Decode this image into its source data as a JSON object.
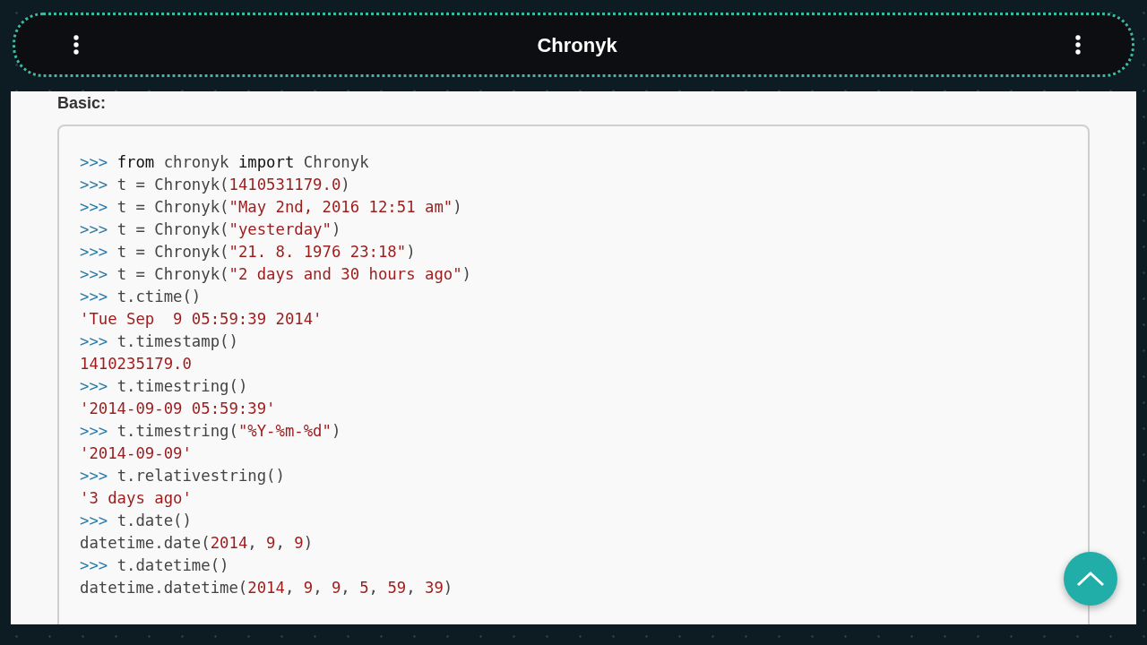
{
  "app_bar": {
    "title": "Chronyk"
  },
  "section": {
    "heading": "Basic:"
  },
  "code_lines": [
    [
      {
        "kind": "prompt",
        "text": ">>> "
      },
      {
        "kind": "keyword",
        "text": "from"
      },
      {
        "kind": "plain",
        "text": " chronyk "
      },
      {
        "kind": "keyword",
        "text": "import"
      },
      {
        "kind": "plain",
        "text": " Chronyk"
      }
    ],
    [
      {
        "kind": "prompt",
        "text": ">>> "
      },
      {
        "kind": "plain",
        "text": "t = Chronyk("
      },
      {
        "kind": "literal",
        "text": "1410531179.0"
      },
      {
        "kind": "plain",
        "text": ")"
      }
    ],
    [
      {
        "kind": "prompt",
        "text": ">>> "
      },
      {
        "kind": "plain",
        "text": "t = Chronyk("
      },
      {
        "kind": "literal",
        "text": "\"May 2nd, 2016 12:51 am\""
      },
      {
        "kind": "plain",
        "text": ")"
      }
    ],
    [
      {
        "kind": "prompt",
        "text": ">>> "
      },
      {
        "kind": "plain",
        "text": "t = Chronyk("
      },
      {
        "kind": "literal",
        "text": "\"yesterday\""
      },
      {
        "kind": "plain",
        "text": ")"
      }
    ],
    [
      {
        "kind": "prompt",
        "text": ">>> "
      },
      {
        "kind": "plain",
        "text": "t = Chronyk("
      },
      {
        "kind": "literal",
        "text": "\"21. 8. 1976 23:18\""
      },
      {
        "kind": "plain",
        "text": ")"
      }
    ],
    [
      {
        "kind": "prompt",
        "text": ">>> "
      },
      {
        "kind": "plain",
        "text": "t = Chronyk("
      },
      {
        "kind": "literal",
        "text": "\"2 days and 30 hours ago\""
      },
      {
        "kind": "plain",
        "text": ")"
      }
    ],
    [
      {
        "kind": "prompt",
        "text": ">>> "
      },
      {
        "kind": "plain",
        "text": "t.ctime()"
      }
    ],
    [
      {
        "kind": "literal",
        "text": "'Tue Sep  9 05:59:39 2014'"
      }
    ],
    [
      {
        "kind": "prompt",
        "text": ">>> "
      },
      {
        "kind": "plain",
        "text": "t.timestamp()"
      }
    ],
    [
      {
        "kind": "literal",
        "text": "1410235179.0"
      }
    ],
    [
      {
        "kind": "prompt",
        "text": ">>> "
      },
      {
        "kind": "plain",
        "text": "t.timestring()"
      }
    ],
    [
      {
        "kind": "literal",
        "text": "'2014-09-09 05:59:39'"
      }
    ],
    [
      {
        "kind": "prompt",
        "text": ">>> "
      },
      {
        "kind": "plain",
        "text": "t.timestring("
      },
      {
        "kind": "literal",
        "text": "\"%Y-%m-%d\""
      },
      {
        "kind": "plain",
        "text": ")"
      }
    ],
    [
      {
        "kind": "literal",
        "text": "'2014-09-09'"
      }
    ],
    [
      {
        "kind": "prompt",
        "text": ">>> "
      },
      {
        "kind": "plain",
        "text": "t.relativestring()"
      }
    ],
    [
      {
        "kind": "literal",
        "text": "'3 days ago'"
      }
    ],
    [
      {
        "kind": "prompt",
        "text": ">>> "
      },
      {
        "kind": "plain",
        "text": "t.date()"
      }
    ],
    [
      {
        "kind": "plain",
        "text": "datetime.date("
      },
      {
        "kind": "literal",
        "text": "2014"
      },
      {
        "kind": "plain",
        "text": ", "
      },
      {
        "kind": "literal",
        "text": "9"
      },
      {
        "kind": "plain",
        "text": ", "
      },
      {
        "kind": "literal",
        "text": "9"
      },
      {
        "kind": "plain",
        "text": ")"
      }
    ],
    [
      {
        "kind": "prompt",
        "text": ">>> "
      },
      {
        "kind": "plain",
        "text": "t.datetime()"
      }
    ],
    [
      {
        "kind": "plain",
        "text": "datetime.datetime("
      },
      {
        "kind": "literal",
        "text": "2014"
      },
      {
        "kind": "plain",
        "text": ", "
      },
      {
        "kind": "literal",
        "text": "9"
      },
      {
        "kind": "plain",
        "text": ", "
      },
      {
        "kind": "literal",
        "text": "9"
      },
      {
        "kind": "plain",
        "text": ", "
      },
      {
        "kind": "literal",
        "text": "5"
      },
      {
        "kind": "plain",
        "text": ", "
      },
      {
        "kind": "literal",
        "text": "59"
      },
      {
        "kind": "plain",
        "text": ", "
      },
      {
        "kind": "literal",
        "text": "39"
      },
      {
        "kind": "plain",
        "text": ")"
      }
    ]
  ]
}
